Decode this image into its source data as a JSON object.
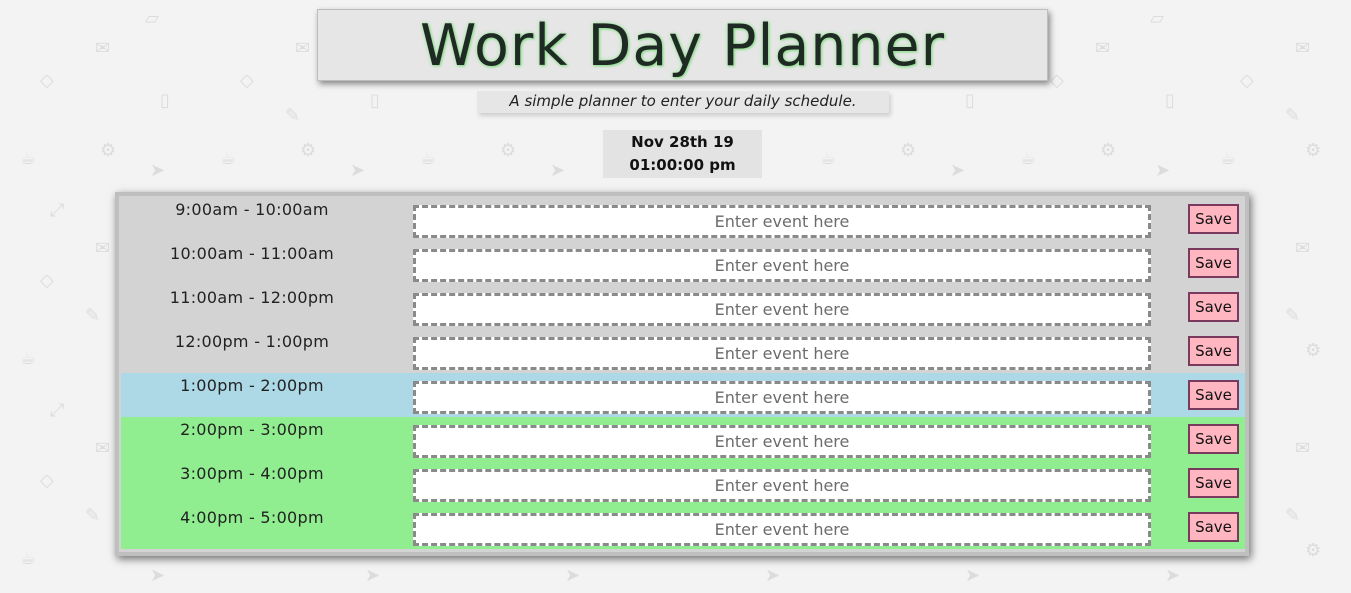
{
  "header": {
    "title": "Work Day Planner",
    "subtitle": "A simple planner to enter your daily schedule."
  },
  "datetime": {
    "date": "Nov 28th 19",
    "time": "01:00:00 pm"
  },
  "colors": {
    "past": "#d3d3d3",
    "present": "#add8e6",
    "future": "#90ee90",
    "save_button": "#ffb6c1"
  },
  "planner": {
    "rows": [
      {
        "hour": "9:00am - 10:00am",
        "status": "past",
        "value": "",
        "placeholder": "Enter event here",
        "save_label": "Save"
      },
      {
        "hour": "10:00am - 11:00am",
        "status": "past",
        "value": "",
        "placeholder": "Enter event here",
        "save_label": "Save"
      },
      {
        "hour": "11:00am - 12:00pm",
        "status": "past",
        "value": "",
        "placeholder": "Enter event here",
        "save_label": "Save"
      },
      {
        "hour": "12:00pm - 1:00pm",
        "status": "past",
        "value": "",
        "placeholder": "Enter event here",
        "save_label": "Save"
      },
      {
        "hour": "1:00pm - 2:00pm",
        "status": "present",
        "value": "",
        "placeholder": "Enter event here",
        "save_label": "Save"
      },
      {
        "hour": "2:00pm - 3:00pm",
        "status": "future",
        "value": "",
        "placeholder": "Enter event here",
        "save_label": "Save"
      },
      {
        "hour": "3:00pm - 4:00pm",
        "status": "future",
        "value": "",
        "placeholder": "Enter event here",
        "save_label": "Save"
      },
      {
        "hour": "4:00pm - 5:00pm",
        "status": "future",
        "value": "",
        "placeholder": "Enter event here",
        "save_label": "Save"
      }
    ]
  }
}
